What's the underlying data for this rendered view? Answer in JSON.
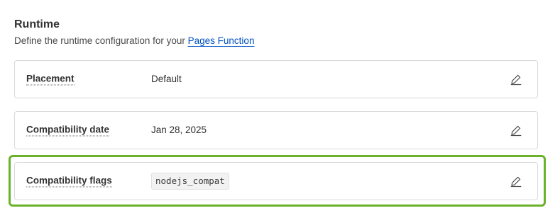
{
  "runtime": {
    "title": "Runtime",
    "description_prefix": "Define the runtime configuration for your ",
    "description_link": "Pages Function"
  },
  "rows": [
    {
      "label": "Placement",
      "value": "Default",
      "icon": "pencil-edit-icon"
    },
    {
      "label": "Compatibility date",
      "value": "Jan 28, 2025",
      "icon": "pencil-edit-icon"
    },
    {
      "label": "Compatibility flags",
      "value": "nodejs_compat",
      "icon": "pencil-edit-icon"
    }
  ],
  "colors": {
    "link": "#0051c3",
    "highlight": "#6bb22a",
    "border": "#d9d9d9"
  }
}
